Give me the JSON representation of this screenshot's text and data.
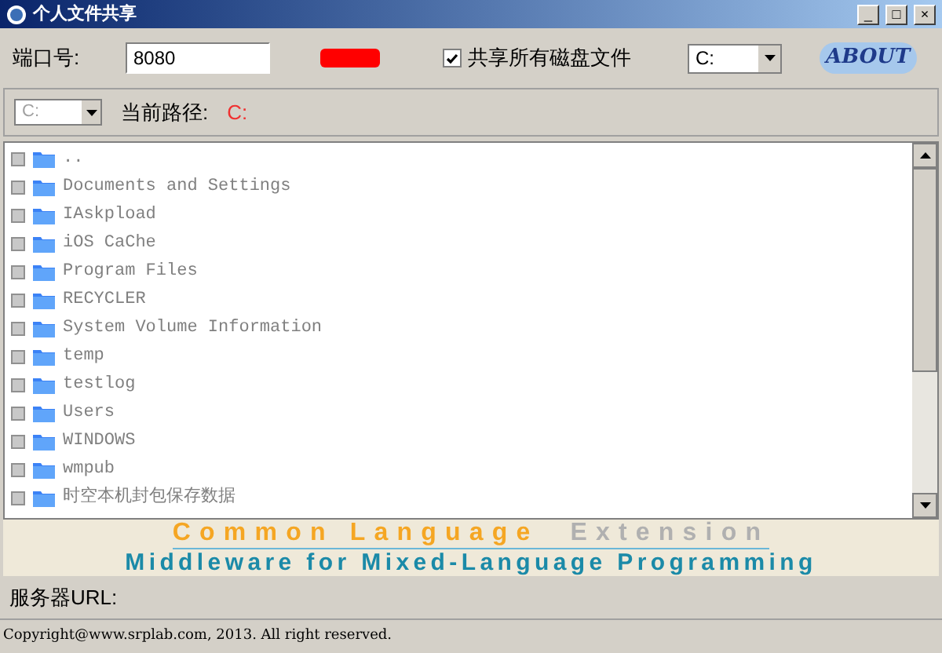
{
  "window": {
    "title": "个人文件共享",
    "controls": [
      "_",
      "□",
      "×"
    ]
  },
  "toolbar": {
    "port_label": "端口号:",
    "port_value": "8080",
    "share_all": {
      "label": "共享所有磁盘文件",
      "checked": true
    },
    "drive_select": "C:",
    "about": "ABOUT"
  },
  "path_bar": {
    "drive_select": "C:",
    "path_label": "当前路径:",
    "path_value": "C:"
  },
  "files": [
    {
      "name": "..",
      "checked": false
    },
    {
      "name": "Documents and Settings",
      "checked": false
    },
    {
      "name": "IAskpload",
      "checked": false
    },
    {
      "name": "iOS CaChe",
      "checked": false
    },
    {
      "name": "Program Files",
      "checked": false
    },
    {
      "name": "RECYCLER",
      "checked": false
    },
    {
      "name": "System Volume Information",
      "checked": false
    },
    {
      "name": "temp",
      "checked": false
    },
    {
      "name": "testlog",
      "checked": false
    },
    {
      "name": "Users",
      "checked": false
    },
    {
      "name": "WINDOWS",
      "checked": false
    },
    {
      "name": "wmpub",
      "checked": false
    },
    {
      "name": "时空本机封包保存数据",
      "checked": false
    }
  ],
  "banner": {
    "line1_a": "Common Language",
    "line1_b": "Extension",
    "line2": "Middleware for Mixed-Language Programming"
  },
  "server_url_label": "服务器URL:",
  "status_bar": "Copyright@www.srplab.com, 2013.  All right reserved."
}
